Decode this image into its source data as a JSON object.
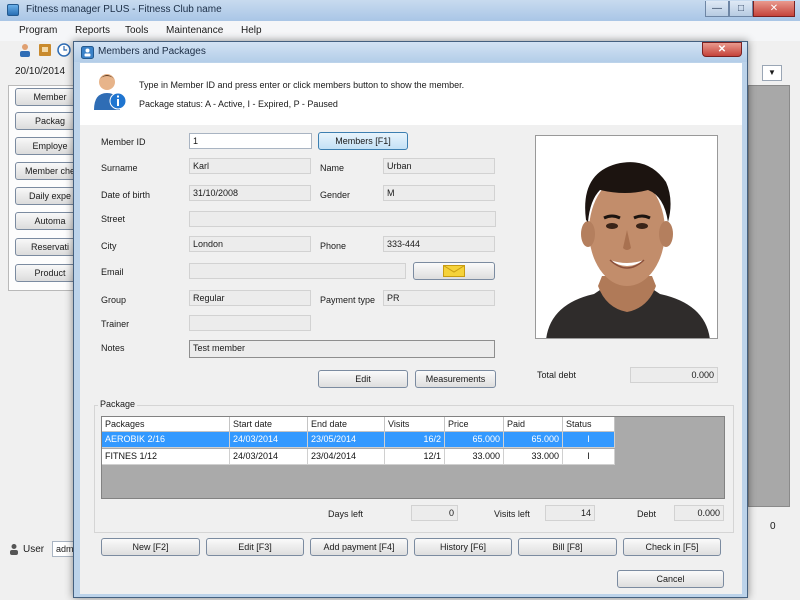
{
  "main_window": {
    "title": "Fitness manager PLUS - Fitness Club name",
    "menu": [
      "Program",
      "Reports",
      "Tools",
      "Maintenance",
      "Help"
    ],
    "date": "20/10/2014",
    "side_buttons": [
      "Member",
      "Packag",
      "Employe",
      "Member che",
      "Daily expe",
      "Automa",
      "Reservati",
      "Product"
    ],
    "user_label": "User",
    "user_value": "adm",
    "right_count": "0"
  },
  "dialog": {
    "title": "Members and Packages",
    "close_glyph": "✕",
    "hint_line1": "Type in Member ID and press enter or click members button to show the member.",
    "hint_line2": "Package status: A - Active, I - Expired, P - Paused",
    "labels": {
      "member_id": "Member ID",
      "surname": "Surname",
      "name": "Name",
      "dob": "Date of birth",
      "gender": "Gender",
      "street": "Street",
      "city": "City",
      "phone": "Phone",
      "email": "Email",
      "group": "Group",
      "payment_type": "Payment  type",
      "trainer": "Trainer",
      "notes": "Notes",
      "total_debt": "Total debt",
      "package_section": "Package",
      "days_left": "Days left",
      "visits_left": "Visits left",
      "debt": "Debt"
    },
    "values": {
      "member_id": "1",
      "surname": "Karl",
      "name": "Urban",
      "dob": "31/10/2008",
      "gender": "M",
      "street": "",
      "city": "London",
      "phone": "333-444",
      "email": "",
      "group": "Regular",
      "payment_type": "PR",
      "trainer": "",
      "notes": "Test member",
      "total_debt": "0.000",
      "days_left": "0",
      "visits_left": "14",
      "debt": "0.000"
    },
    "buttons": {
      "members": "Members  [F1]",
      "edit_member": "Edit",
      "measurements": "Measurements",
      "new": "New [F2]",
      "edit": "Edit  [F3]",
      "add_payment": "Add payment [F4]",
      "history": "History [F6]",
      "bill": "Bill [F8]",
      "check_in": "Check in [F5]",
      "cancel": "Cancel"
    },
    "package_table": {
      "columns": [
        "Packages",
        "Start date",
        "End date",
        "Visits",
        "Price",
        "Paid",
        "Status"
      ],
      "rows": [
        {
          "package": "AEROBIK 2/16",
          "start": "24/03/2014",
          "end": "23/05/2014",
          "visits": "16/2",
          "price": "65.000",
          "paid": "65.000",
          "status": "I",
          "selected": true
        },
        {
          "package": "FITNES 1/12",
          "start": "24/03/2014",
          "end": "23/04/2014",
          "visits": "12/1",
          "price": "33.000",
          "paid": "33.000",
          "status": "I",
          "selected": false
        }
      ]
    }
  },
  "colors": {
    "selection": "#3399ff",
    "dialog_frame": "#bcd3ea",
    "close_button": "#c5433a"
  },
  "icons": [
    "app-icon",
    "members-icon",
    "user-info-icon",
    "envelope-icon",
    "member-photo"
  ]
}
